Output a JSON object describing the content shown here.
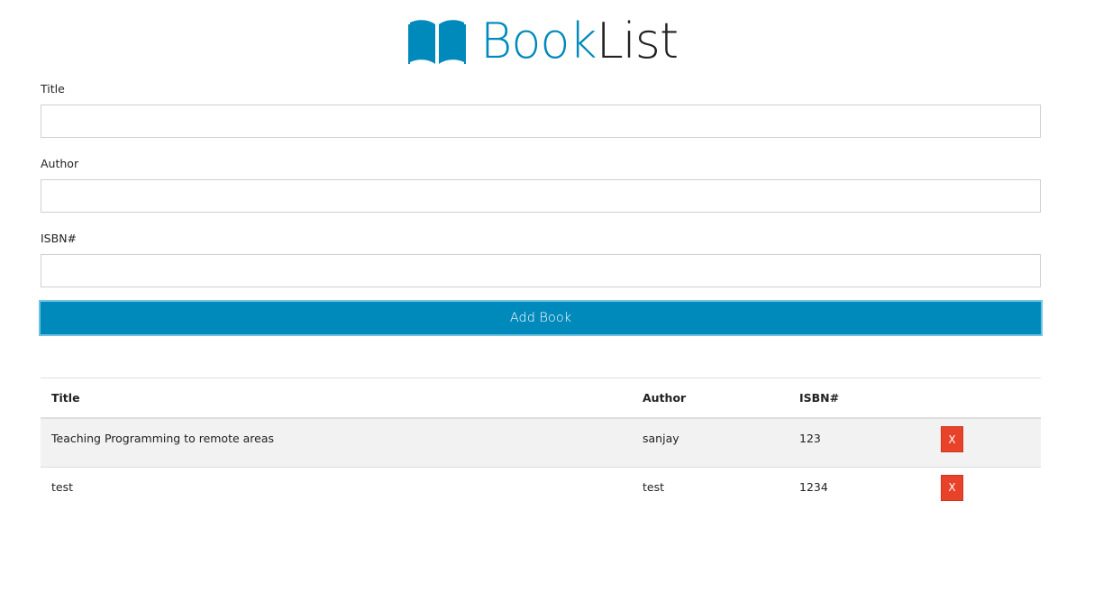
{
  "header": {
    "brand_part1": "Book",
    "brand_part2": "List",
    "icon": "book-open-icon"
  },
  "form": {
    "title_label": "Title",
    "title_value": "",
    "author_label": "Author",
    "author_value": "",
    "isbn_label": "ISBN#",
    "isbn_value": "",
    "submit_label": "Add Book"
  },
  "table": {
    "headers": [
      "Title",
      "Author",
      "ISBN#",
      ""
    ],
    "rows": [
      {
        "title": "Teaching Programming to remote areas",
        "author": "sanjay",
        "isbn": "123",
        "delete_label": "X"
      },
      {
        "title": "test",
        "author": "test",
        "isbn": "1234",
        "delete_label": "X"
      }
    ]
  },
  "colors": {
    "brand": "#0089bb",
    "danger": "#e8432a",
    "row_alt": "#f2f2f2"
  }
}
